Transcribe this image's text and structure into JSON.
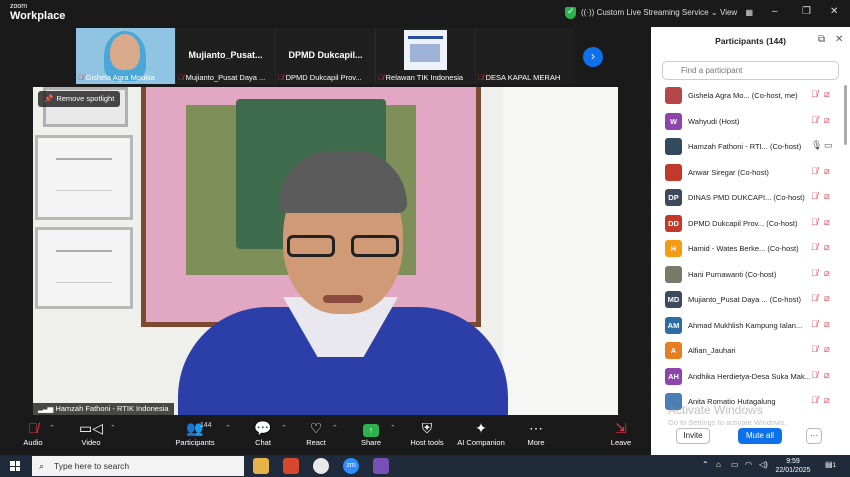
{
  "titlebar": {
    "logo_line1": "zoom",
    "logo_line2": "Workplace",
    "streaming": "Custom Live Streaming Service",
    "view": "View",
    "minimize": "–",
    "maximize": "❐",
    "close": "✕"
  },
  "thumbnails": [
    {
      "label": "Gishela Agra Moukia",
      "big": ""
    },
    {
      "label": "Mujianto_Pusat Daya ...",
      "big": "Mujianto_Pusat..."
    },
    {
      "label": "DPMD Dukcapil Prov...",
      "big": "DPMD Dukcapil..."
    },
    {
      "label": "Relawan TIK Indonesia",
      "big": ""
    },
    {
      "label": "DESA KAPAL MERAH",
      "big": ""
    }
  ],
  "video": {
    "spotlight_label": "Remove spotlight",
    "speaker_name": "Hamzah Fathoni - RTIK Indonesia"
  },
  "toolbar": {
    "audio": "Audio",
    "video": "Video",
    "participants": "Participants",
    "participants_count": "144",
    "chat": "Chat",
    "react": "React",
    "share": "Share",
    "host_tools": "Host tools",
    "ai_companion": "AI Companion",
    "more": "More",
    "leave": "Leave"
  },
  "panel": {
    "title": "Participants (144)",
    "search_placeholder": "Find a participant",
    "invite": "Invite",
    "mute_all": "Mute all",
    "more": "···",
    "watermark_title": "Activate Windows",
    "watermark_sub": "Go to Settings to activate Windows.",
    "participants": [
      {
        "initials": "",
        "color": "#b7464a",
        "name": "Gishela Agra Mo... (Co-host, me)",
        "mic_on": false,
        "cam_on": false
      },
      {
        "initials": "W",
        "color": "#8e44ad",
        "name": "Wahyudi (Host)",
        "mic_on": false,
        "cam_on": false
      },
      {
        "initials": "",
        "color": "#34495e",
        "name": "Hamzah Fathoni - RTI... (Co-host)",
        "mic_on": true,
        "cam_on": true
      },
      {
        "initials": "",
        "color": "#c0392b",
        "name": "Anwar Siregar (Co-host)",
        "mic_on": false,
        "cam_on": false
      },
      {
        "initials": "DP",
        "color": "#3d4a5c",
        "name": "DINAS PMD DUKCAPI... (Co-host)",
        "mic_on": false,
        "cam_on": false
      },
      {
        "initials": "DD",
        "color": "#c0392b",
        "name": "DPMD Dukcapil Prov... (Co-host)",
        "mic_on": false,
        "cam_on": false
      },
      {
        "initials": "H",
        "color": "#f39c12",
        "name": "Hamid - Wates Berke... (Co-host)",
        "mic_on": false,
        "cam_on": false
      },
      {
        "initials": "",
        "color": "#7a7a6a",
        "name": "Hani Purnawanti (Co-host)",
        "mic_on": false,
        "cam_on": false
      },
      {
        "initials": "MD",
        "color": "#3d4a5c",
        "name": "Mujianto_Pusat Daya ... (Co-host)",
        "mic_on": false,
        "cam_on": false
      },
      {
        "initials": "AM",
        "color": "#2e6da4",
        "name": "Ahmad Mukhlish Kampung Ialan...",
        "mic_on": false,
        "cam_on": false
      },
      {
        "initials": "A",
        "color": "#e67e22",
        "name": "Alfian_Jauhari",
        "mic_on": false,
        "cam_on": false
      },
      {
        "initials": "AH",
        "color": "#8e44ad",
        "name": "Andhika Herdietya-Desa Suka Mak...",
        "mic_on": false,
        "cam_on": false
      },
      {
        "initials": "",
        "color": "#4a7fb5",
        "name": "Anita Romatio Hutagalung",
        "mic_on": false,
        "cam_on": false
      }
    ]
  },
  "taskbar": {
    "search_placeholder": "Type here to search",
    "time": "9:59",
    "date": "22/01/2025",
    "notifications": "1"
  }
}
